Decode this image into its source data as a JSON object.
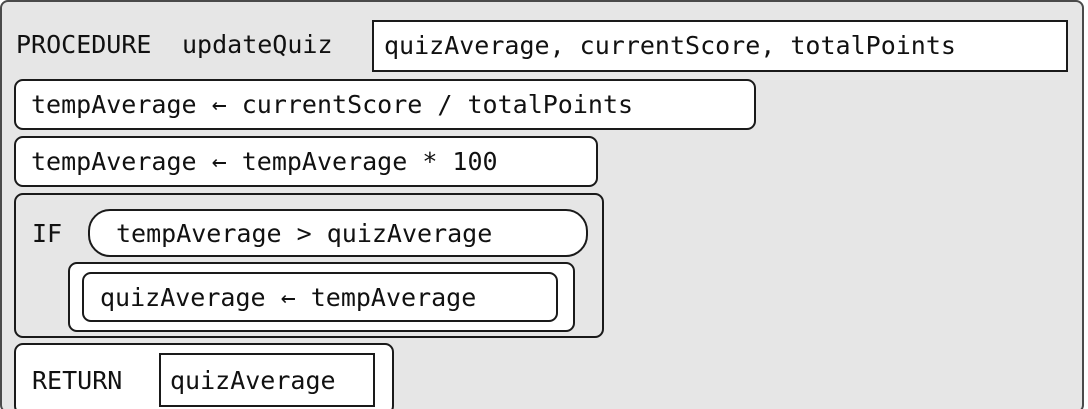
{
  "procedure": {
    "keyword": "PROCEDURE",
    "name": "updateQuiz",
    "params": "quizAverage, currentScore, totalPoints"
  },
  "statements": {
    "assign1": "tempAverage ← currentScore / totalPoints",
    "assign2": "tempAverage ← tempAverage * 100"
  },
  "if_block": {
    "keyword": "IF",
    "condition": "tempAverage > quizAverage",
    "body": "quizAverage ← tempAverage"
  },
  "return_block": {
    "keyword": "RETURN",
    "value": "quizAverage"
  }
}
